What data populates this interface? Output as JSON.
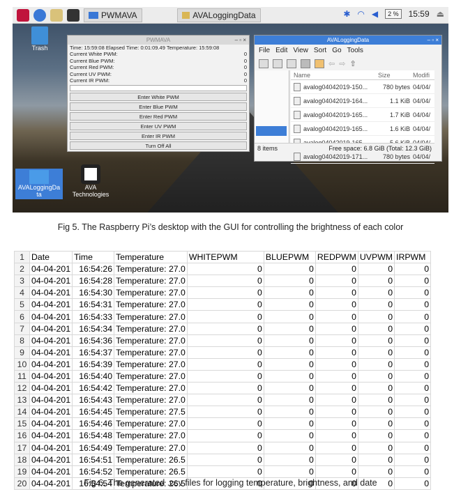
{
  "screenshot": {
    "taskbar": {
      "app_button": "PWMAVA",
      "folder_button": "AVALoggingData",
      "battery": "2 %",
      "clock": "15:59"
    },
    "desktop_icons": [
      {
        "label": "Trash"
      },
      {
        "label": "AVALoggingDa ta"
      },
      {
        "label": "AVA Technologies"
      }
    ],
    "pwm_window": {
      "title": "PWMAVA",
      "status_line": "Time: 15:59:08 Elapsed Time: 0:01:09.49 Temperature: 15:59:08",
      "readouts": [
        {
          "label": "Current White PWM:",
          "value": "0"
        },
        {
          "label": "Current Blue PWM:",
          "value": "0"
        },
        {
          "label": "Current Red PWM:",
          "value": "0"
        },
        {
          "label": "Current UV PWM:",
          "value": "0"
        },
        {
          "label": "Current IR PWM:",
          "value": "0"
        }
      ],
      "buttons": [
        "Enter White PWM",
        "Enter Blue PWM",
        "Enter Red PWM",
        "Enter UV PWM",
        "Enter IR PWM",
        "Turn Off All"
      ]
    },
    "file_window": {
      "title": "AVALoggingData",
      "menu": [
        "File",
        "Edit",
        "View",
        "Sort",
        "Go",
        "Tools"
      ],
      "columns": [
        "Name",
        "Size",
        "Modifi"
      ],
      "files": [
        {
          "name": "avalog04042019-150...",
          "size": "780 bytes",
          "mod": "04/04/"
        },
        {
          "name": "avalog04042019-164...",
          "size": "1.1 KiB",
          "mod": "04/04/"
        },
        {
          "name": "avalog04042019-165...",
          "size": "1.7 KiB",
          "mod": "04/04/"
        },
        {
          "name": "avalog04042019-165...",
          "size": "1.6 KiB",
          "mod": "04/04/"
        },
        {
          "name": "avalog04042019-165...",
          "size": "5.6 KiB",
          "mod": "04/04/"
        },
        {
          "name": "avalog04042019-171...",
          "size": "780 bytes",
          "mod": "04/04/"
        }
      ],
      "item_count": "8 items",
      "free_space": "Free space: 6.8 GiB (Total: 12.3 GiB)"
    }
  },
  "caption5": "Fig 5. The Raspberry Pi’s desktop with the GUI for controlling the brightness of each color",
  "caption6": "Fig 6. The generated .csv files for logging temperature, brightness, and date",
  "csv": {
    "header": [
      "1",
      "Date",
      "Time",
      "Temperature",
      "WHITEPWM",
      "BLUEPWM",
      "REDPWM",
      "UVPWM",
      "IRPWM"
    ],
    "rows": [
      [
        "2",
        "04-04-201",
        "16:54:26",
        "Temperature: 27.0",
        "0",
        "0",
        "0",
        "0",
        "0"
      ],
      [
        "3",
        "04-04-201",
        "16:54:28",
        "Temperature: 27.0",
        "0",
        "0",
        "0",
        "0",
        "0"
      ],
      [
        "4",
        "04-04-201",
        "16:54:30",
        "Temperature: 27.0",
        "0",
        "0",
        "0",
        "0",
        "0"
      ],
      [
        "5",
        "04-04-201",
        "16:54:31",
        "Temperature: 27.0",
        "0",
        "0",
        "0",
        "0",
        "0"
      ],
      [
        "6",
        "04-04-201",
        "16:54:33",
        "Temperature: 27.0",
        "0",
        "0",
        "0",
        "0",
        "0"
      ],
      [
        "7",
        "04-04-201",
        "16:54:34",
        "Temperature: 27.0",
        "0",
        "0",
        "0",
        "0",
        "0"
      ],
      [
        "8",
        "04-04-201",
        "16:54:36",
        "Temperature: 27.0",
        "0",
        "0",
        "0",
        "0",
        "0"
      ],
      [
        "9",
        "04-04-201",
        "16:54:37",
        "Temperature: 27.0",
        "0",
        "0",
        "0",
        "0",
        "0"
      ],
      [
        "10",
        "04-04-201",
        "16:54:39",
        "Temperature: 27.0",
        "0",
        "0",
        "0",
        "0",
        "0"
      ],
      [
        "11",
        "04-04-201",
        "16:54:40",
        "Temperature: 27.0",
        "0",
        "0",
        "0",
        "0",
        "0"
      ],
      [
        "12",
        "04-04-201",
        "16:54:42",
        "Temperature: 27.0",
        "0",
        "0",
        "0",
        "0",
        "0"
      ],
      [
        "13",
        "04-04-201",
        "16:54:43",
        "Temperature: 27.0",
        "0",
        "0",
        "0",
        "0",
        "0"
      ],
      [
        "14",
        "04-04-201",
        "16:54:45",
        "Temperature: 27.5",
        "0",
        "0",
        "0",
        "0",
        "0"
      ],
      [
        "15",
        "04-04-201",
        "16:54:46",
        "Temperature: 27.0",
        "0",
        "0",
        "0",
        "0",
        "0"
      ],
      [
        "16",
        "04-04-201",
        "16:54:48",
        "Temperature: 27.0",
        "0",
        "0",
        "0",
        "0",
        "0"
      ],
      [
        "17",
        "04-04-201",
        "16:54:49",
        "Temperature: 27.0",
        "0",
        "0",
        "0",
        "0",
        "0"
      ],
      [
        "18",
        "04-04-201",
        "16:54:51",
        "Temperature: 26.5",
        "0",
        "0",
        "0",
        "0",
        "0"
      ],
      [
        "19",
        "04-04-201",
        "16:54:52",
        "Temperature: 26.5",
        "0",
        "0",
        "0",
        "0",
        "0"
      ],
      [
        "20",
        "04-04-201",
        "16:54:54",
        "Temperature: 26.5",
        "0",
        "0",
        "0",
        "0",
        "0"
      ]
    ]
  }
}
